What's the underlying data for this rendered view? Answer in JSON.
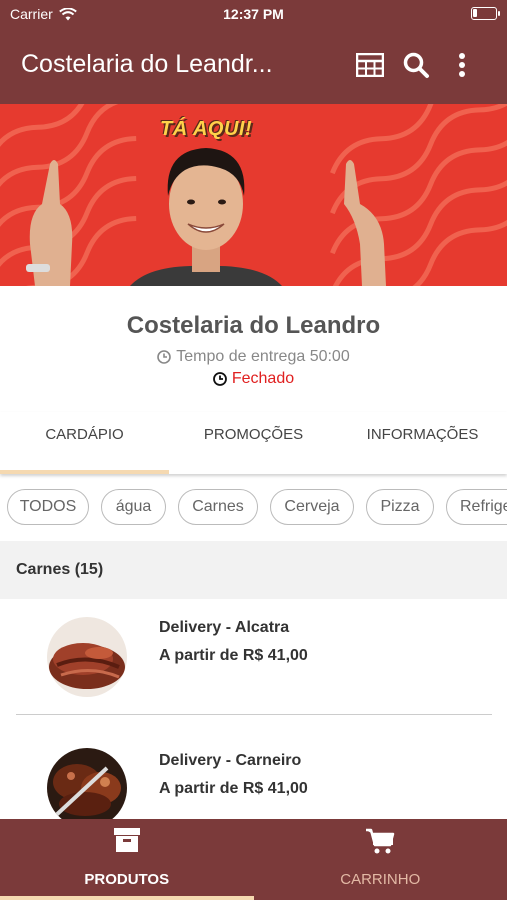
{
  "status_bar": {
    "carrier": "Carrier",
    "time": "12:37 PM",
    "battery_level": 0.2
  },
  "app_bar": {
    "title": "Costelaria do Leandr...",
    "icons": [
      "table-icon",
      "search-icon",
      "more-vert-icon"
    ]
  },
  "banner": {
    "caption": "TÁ AQUI!"
  },
  "restaurant": {
    "name": "Costelaria do Leandro",
    "delivery_time": "Tempo de entrega 50:00",
    "status": "Fechado",
    "status_color": "#e02020"
  },
  "tabs": [
    {
      "label": "CARDÁPIO",
      "active": true
    },
    {
      "label": "PROMOÇÕES",
      "active": false
    },
    {
      "label": "INFORMAÇÕES",
      "active": false
    }
  ],
  "categories": [
    "TODOS",
    "água",
    "Carnes",
    "Cerveja",
    "Pizza",
    "Refrigerante"
  ],
  "section": {
    "title": "Carnes (15)"
  },
  "products": [
    {
      "name": "Delivery - Alcatra",
      "price": "A partir de R$ 41,00"
    },
    {
      "name": "Delivery - Carneiro",
      "price": "A partir de R$ 41,00"
    }
  ],
  "bottom_nav": [
    {
      "label": "PRODUTOS",
      "icon": "archive-box-icon",
      "active": true
    },
    {
      "label": "CARRINHO",
      "icon": "cart-icon",
      "active": false
    }
  ],
  "colors": {
    "primary": "#7b3a3a",
    "accent": "#f5d9b1",
    "banner_red": "#e63a2f"
  }
}
